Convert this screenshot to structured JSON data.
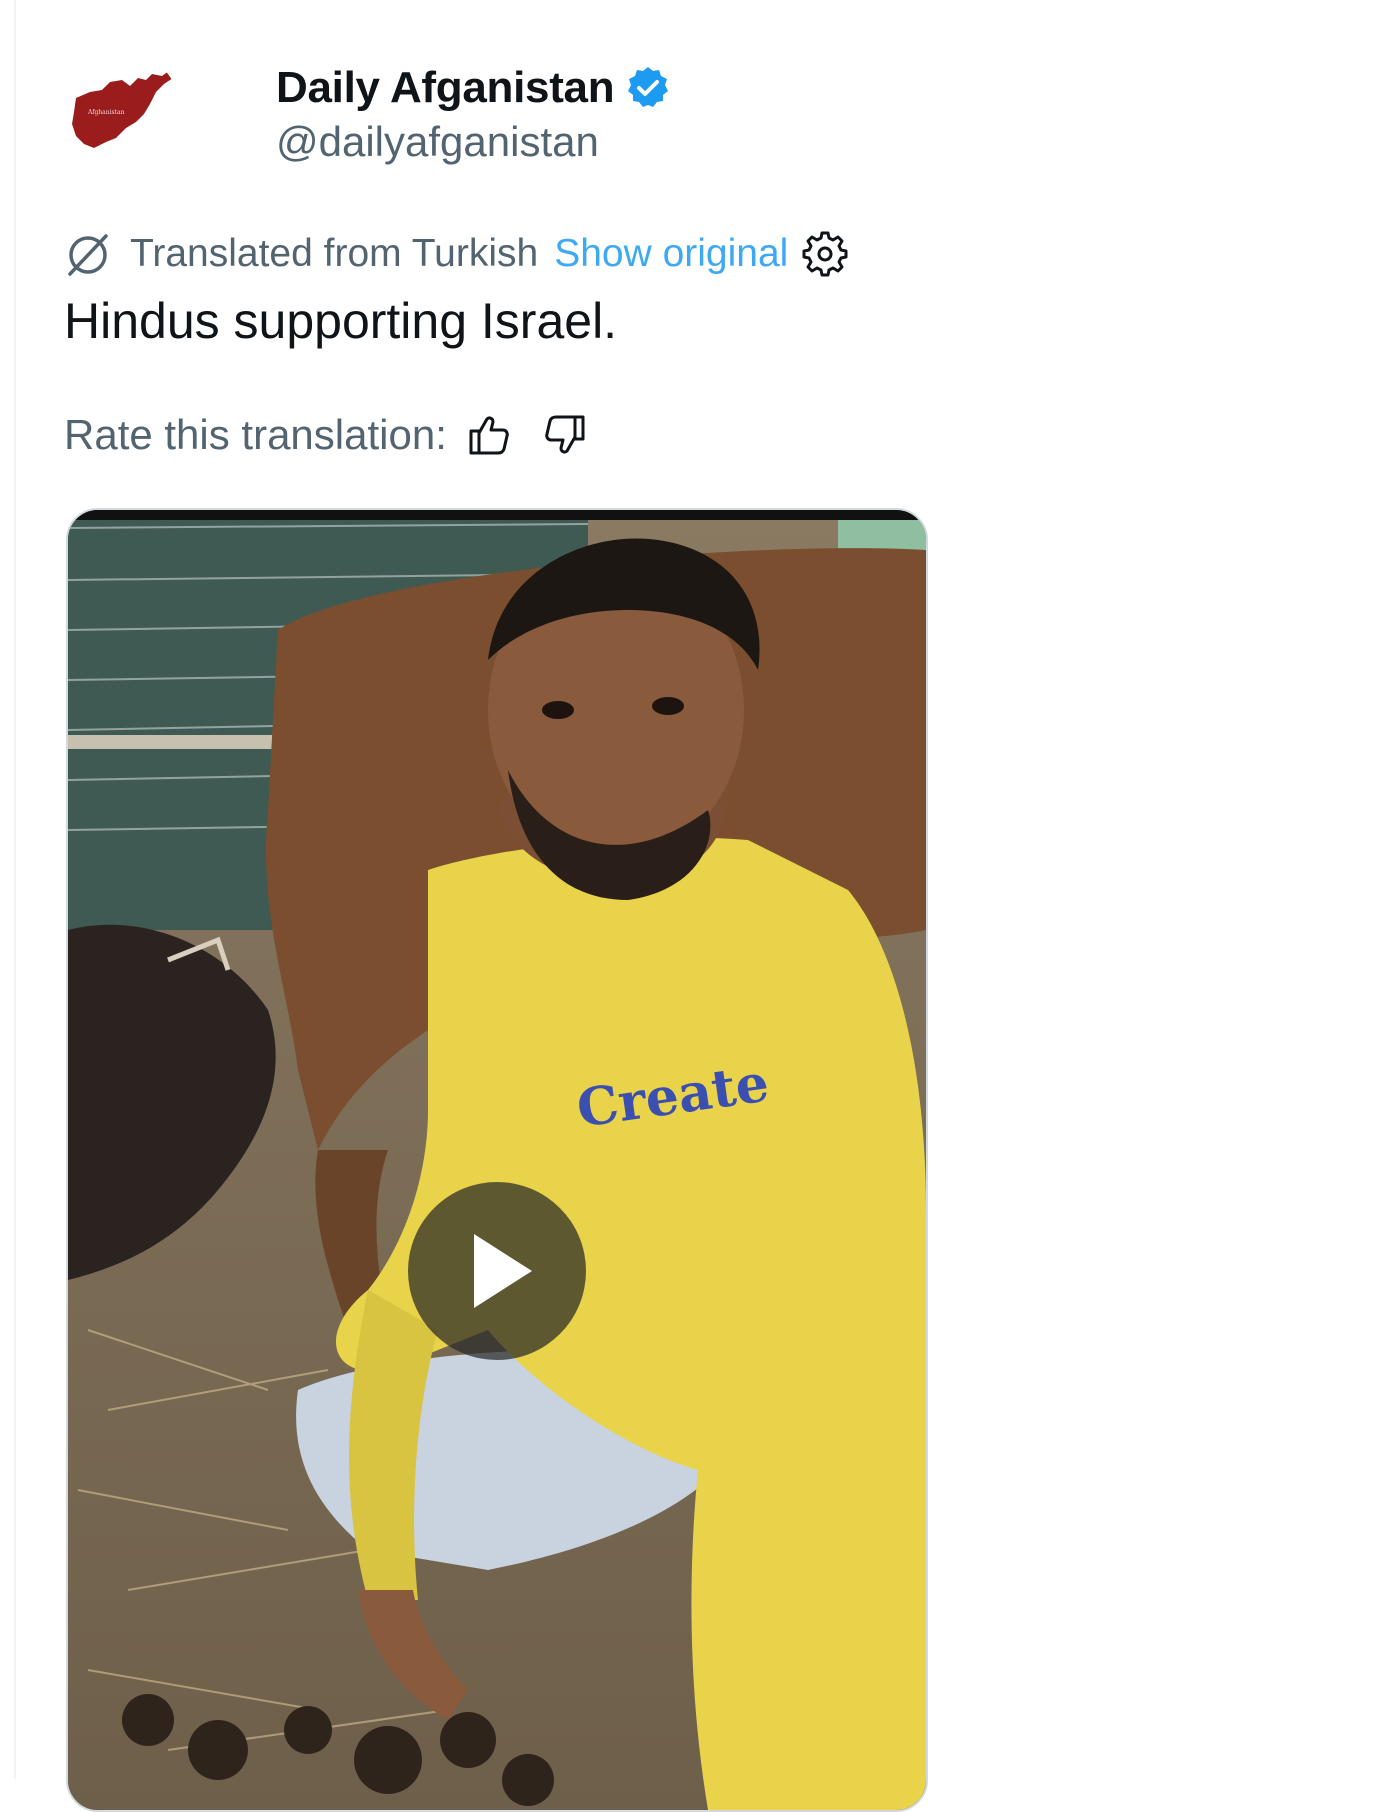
{
  "tweet": {
    "author": {
      "display_name": "Daily Afganistan",
      "handle": "@dailyafganistan",
      "avatar_label": "Afghanistan",
      "verified": true
    },
    "translation": {
      "label": "Translated from Turkish",
      "show_original": "Show original"
    },
    "text": "Hindus supporting Israel.",
    "rating": {
      "label": "Rate this translation:"
    },
    "media": {
      "type": "video",
      "shirt_text": "Create"
    }
  },
  "colors": {
    "accent": "#1d9bf0",
    "secondary_text": "#536471",
    "primary_text": "#0f1419",
    "verified_badge": "#1d9bf0",
    "avatar_map": "#9b1c1c",
    "shirt": "#e8d34a"
  },
  "icons": {
    "verified": "verified-badge-icon",
    "translate": "globe-slash-icon",
    "settings": "gear-icon",
    "like": "thumbs-up-icon",
    "dislike": "thumbs-down-icon",
    "play": "play-icon"
  }
}
